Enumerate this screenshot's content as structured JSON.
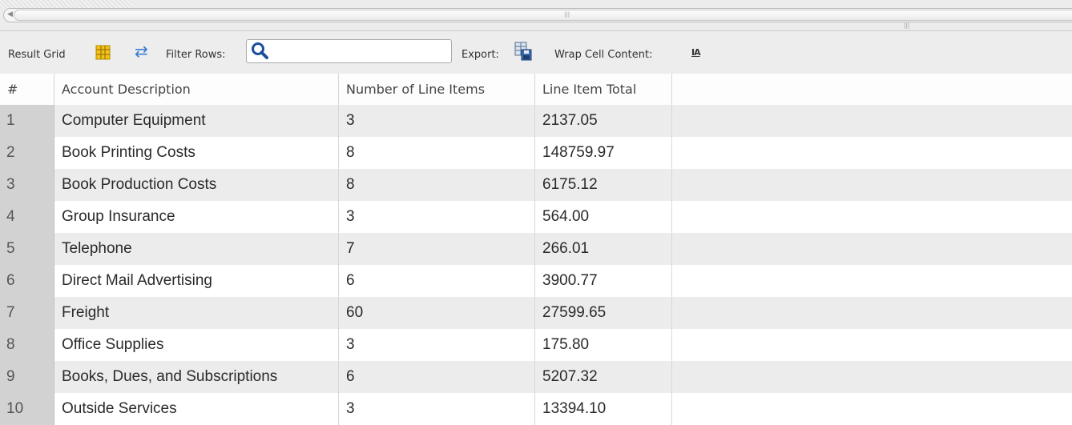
{
  "toolbar": {
    "result_grid_label": "Result Grid",
    "filter_rows_label": "Filter Rows:",
    "filter_value": "",
    "export_label": "Export:",
    "wrap_label": "Wrap Cell Content:",
    "wrap_icon_text": "IA"
  },
  "grid": {
    "columns": [
      "#",
      "Account Description",
      "Number of Line Items",
      "Line Item Total"
    ],
    "rows": [
      [
        "1",
        "Computer Equipment",
        "3",
        "2137.05"
      ],
      [
        "2",
        "Book Printing Costs",
        "8",
        "148759.97"
      ],
      [
        "3",
        "Book Production Costs",
        "8",
        "6175.12"
      ],
      [
        "4",
        "Group Insurance",
        "3",
        "564.00"
      ],
      [
        "5",
        "Telephone",
        "7",
        "266.01"
      ],
      [
        "6",
        "Direct Mail Advertising",
        "6",
        "3900.77"
      ],
      [
        "7",
        "Freight",
        "60",
        "27599.65"
      ],
      [
        "8",
        "Office Supplies",
        "3",
        "175.80"
      ],
      [
        "9",
        "Books, Dues, and Subscriptions",
        "6",
        "5207.32"
      ],
      [
        "10",
        "Outside Services",
        "3",
        "13394.10"
      ]
    ]
  },
  "icons": {
    "result_grid": "grid-icon",
    "filter": "refresh-icon",
    "search": "search-icon",
    "export": "export-icon",
    "wrap": "wrap-text-icon"
  }
}
